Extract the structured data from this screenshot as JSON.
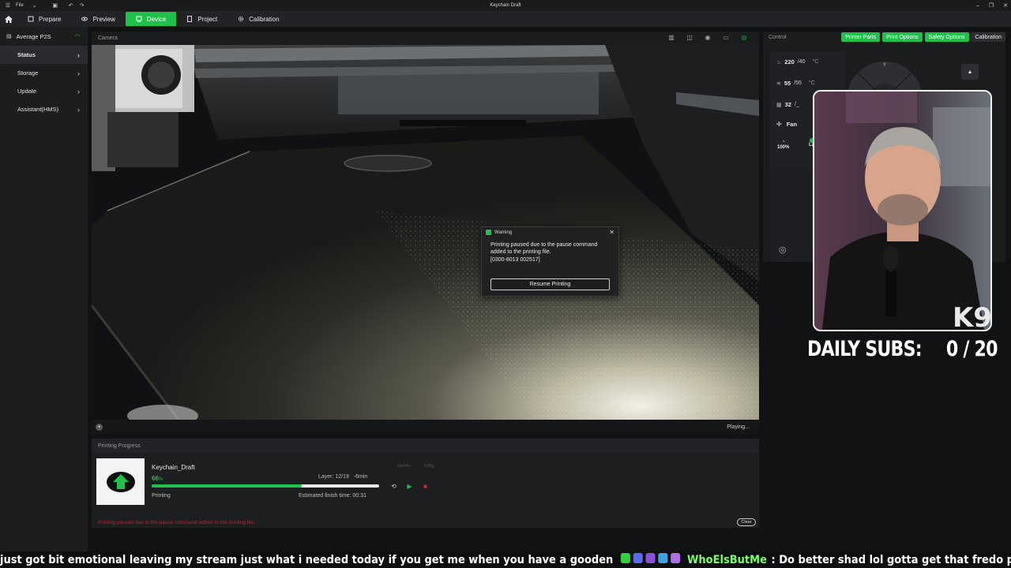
{
  "titlebar": {
    "file_label": "File",
    "window_title": "Keychain Draft"
  },
  "nav": {
    "tabs": [
      {
        "label": "Prepare",
        "icon": "cube-icon"
      },
      {
        "label": "Preview",
        "icon": "eye-icon"
      },
      {
        "label": "Device",
        "icon": "device-icon",
        "active": true
      },
      {
        "label": "Project",
        "icon": "document-icon"
      },
      {
        "label": "Calibration",
        "icon": "gear-icon"
      }
    ]
  },
  "sidebar": {
    "device_name": "Average P2S",
    "items": [
      {
        "label": "Status",
        "active": true
      },
      {
        "label": "Storage"
      },
      {
        "label": "Update"
      },
      {
        "label": "Assistant(HMS)"
      }
    ]
  },
  "camera": {
    "title": "Camera",
    "status": "Playing..."
  },
  "dialog": {
    "title": "Warning",
    "message": "Printing paused due to the pause command added to the printing file.",
    "code": "[0300-8013 002517]",
    "button": "Resume Printing"
  },
  "progress": {
    "title": "Printing Progress",
    "job_name": "Keychain_Draft",
    "percent": 66,
    "percent_label": "66",
    "percent_unit": "%",
    "layer": "Layer: 12/19",
    "remaining": "-6min",
    "faint_time": "19m44s",
    "faint_weight": "5.88g",
    "status": "Printing",
    "finish": "Estimated finish time: 00:31",
    "error_line": "Printing paused due to the pause command added to the printing file",
    "clear_label": "Clear"
  },
  "control": {
    "title": "Control",
    "tabs": [
      {
        "label": "Printer Parts",
        "style": "green"
      },
      {
        "label": "Print Options",
        "style": "green"
      },
      {
        "label": "Safety Options",
        "style": "green"
      },
      {
        "label": "Calibration",
        "style": "dark"
      }
    ],
    "temps": [
      {
        "current": "220",
        "target": "/40",
        "unit": "°C"
      },
      {
        "current": "55",
        "target": "/55",
        "unit": "°C"
      },
      {
        "current": "32",
        "target": "/_",
        "unit": ""
      }
    ],
    "fan_label": "Fan",
    "fan_pct": "100%",
    "fan_sub": "Lar",
    "jog_axis": "Y"
  },
  "overlay": {
    "subs_label": "DAILY SUBS:",
    "subs_count": "0 / 20"
  },
  "ticker": {
    "message1": "just got bit emotional leaving my stream just what i needed today if you get me when you have a gooden",
    "username": "WhoElsButMe",
    "message2": "Do better shad lol gotta get that fredo profits up lol"
  },
  "colors": {
    "accent": "#1fc14a",
    "error": "#c0202a",
    "ticker_user": "#7dfc6a"
  }
}
